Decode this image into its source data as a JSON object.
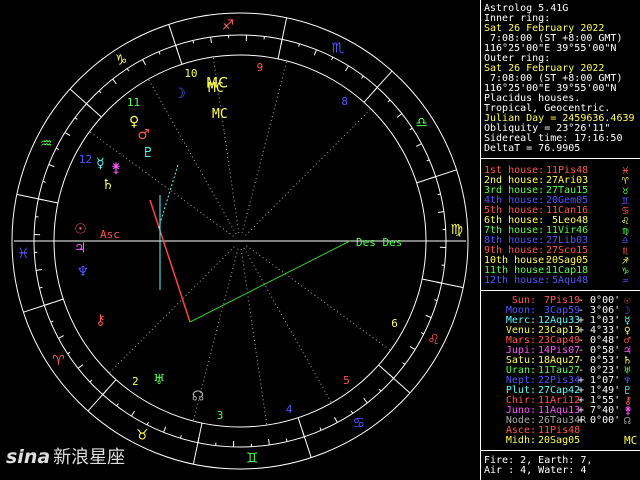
{
  "app": {
    "title": "Astrolog 5.41G"
  },
  "info": {
    "inner_label": "Inner ring:",
    "inner_date": "Sat 26 February 2022",
    "inner_time": " 7:08:00 (ST +8:00 GMT)",
    "inner_loc": "116°25'00\"E 39°55'00\"N",
    "outer_label": "Outer ring:",
    "outer_date": "Sat 26 February 2022",
    "outer_time": " 7:08:00 (ST +8:00 GMT)",
    "outer_loc": "116°25'00\"E 39°55'00\"N",
    "system": "Placidus houses.",
    "zodiac": "Tropical, Geocentric.",
    "julian": "Julian Day = 2459636.4639",
    "obliquity": "Obliquity = 23°26'11\"",
    "sidereal": "Sidereal time: 17:16:50",
    "deltat": "DeltaT = 76.9905"
  },
  "houses": [
    {
      "label": "1st house:",
      "value": "11Pis48",
      "color": "#ff5555",
      "sym": "♓"
    },
    {
      "label": "2nd house:",
      "value": "27Ari03",
      "color": "#ffff55",
      "sym": "♈"
    },
    {
      "label": "3rd house:",
      "value": "27Tau15",
      "color": "#55ff55",
      "sym": "♉"
    },
    {
      "label": "4th house:",
      "value": "20Gem05",
      "color": "#5555ff",
      "sym": "♊"
    },
    {
      "label": "5th house:",
      "value": "11Can16",
      "color": "#ff5555",
      "sym": "♋"
    },
    {
      "label": "6th house:",
      "value": " 5Leo48",
      "color": "#ffff55",
      "sym": "♌"
    },
    {
      "label": "7th house:",
      "value": "11Vir46",
      "color": "#55ff55",
      "sym": "♍"
    },
    {
      "label": "8th house:",
      "value": "27Lib03",
      "color": "#5555ff",
      "sym": "♎"
    },
    {
      "label": "9th house:",
      "value": "27Sco15",
      "color": "#ff5555",
      "sym": "♏"
    },
    {
      "label": "10th house:",
      "value": "20Sag05",
      "color": "#ffff55",
      "sym": "♐"
    },
    {
      "label": "11th house:",
      "value": "11Cap18",
      "color": "#55ff55",
      "sym": "♑"
    },
    {
      "label": "12th house:",
      "value": " 5Aqu48",
      "color": "#5555ff",
      "sym": "♒"
    }
  ],
  "planets": [
    {
      "name": "Sun:",
      "pos": " 7Pis19",
      "speed": "- 0°00'",
      "color": "#ff5555",
      "sym": "☉"
    },
    {
      "name": "Moon:",
      "pos": " 3Cap59",
      "speed": "- 3°06'",
      "color": "#5555ff",
      "sym": "☽"
    },
    {
      "name": "Merc:",
      "pos": "12Aqu33",
      "speed": "+ 1°03'",
      "color": "#55ffff",
      "sym": "☿"
    },
    {
      "name": "Venu:",
      "pos": "23Cap13",
      "speed": "+ 4°33'",
      "color": "#ffff55",
      "sym": "♀"
    },
    {
      "name": "Mars:",
      "pos": "23Cap49",
      "speed": "- 0°48'",
      "color": "#ff5555",
      "sym": "♂"
    },
    {
      "name": "Jupi:",
      "pos": "14Pis07",
      "speed": "- 0°58'",
      "color": "#ff55ff",
      "sym": "♃"
    },
    {
      "name": "Satu:",
      "pos": "18Aqu27",
      "speed": "- 0°53'",
      "color": "#ffff55",
      "sym": "♄"
    },
    {
      "name": "Uran:",
      "pos": "11Tau27",
      "speed": "- 0°23'",
      "color": "#55ff55",
      "sym": "♅"
    },
    {
      "name": "Nept:",
      "pos": "22Pis34",
      "speed": "+ 1°07'",
      "color": "#5555ff",
      "sym": "♆"
    },
    {
      "name": "Plut:",
      "pos": "27Cap42",
      "speed": "+ 1°49'",
      "color": "#55ffff",
      "sym": "♇"
    },
    {
      "name": "Chir:",
      "pos": "11Ari12",
      "speed": "+ 1°55'",
      "color": "#ff5555",
      "sym": "⚷"
    },
    {
      "name": "Juno:",
      "pos": "11Aqu13",
      "speed": "+ 7°40'",
      "color": "#ff55ff",
      "sym": "⚵"
    },
    {
      "name": "Node:",
      "pos": "26Tau34R",
      "speed": "+ 0°00'",
      "color": "#aaaaaa",
      "sym": "☊"
    },
    {
      "name": "Asce:",
      "pos": "11Pis48",
      "speed": "",
      "color": "#ff5555",
      "sym": "Asc"
    },
    {
      "name": "Midh:",
      "pos": "20Sag05",
      "speed": "",
      "color": "#ffff55",
      "sym": "MC"
    }
  ],
  "footer": {
    "line1": "Fire: 2, Earth: 7,",
    "line2": "Air : 4, Water: 4"
  },
  "wheel_labels": {
    "asc": "Asc",
    "des": "Des",
    "mc": "MC"
  },
  "watermark": {
    "brand": "sina",
    "text": "新浪星座"
  },
  "colors": {
    "fire": "#ff5555",
    "earth": "#ffff55",
    "air": "#55ff55",
    "water": "#5555ff"
  }
}
